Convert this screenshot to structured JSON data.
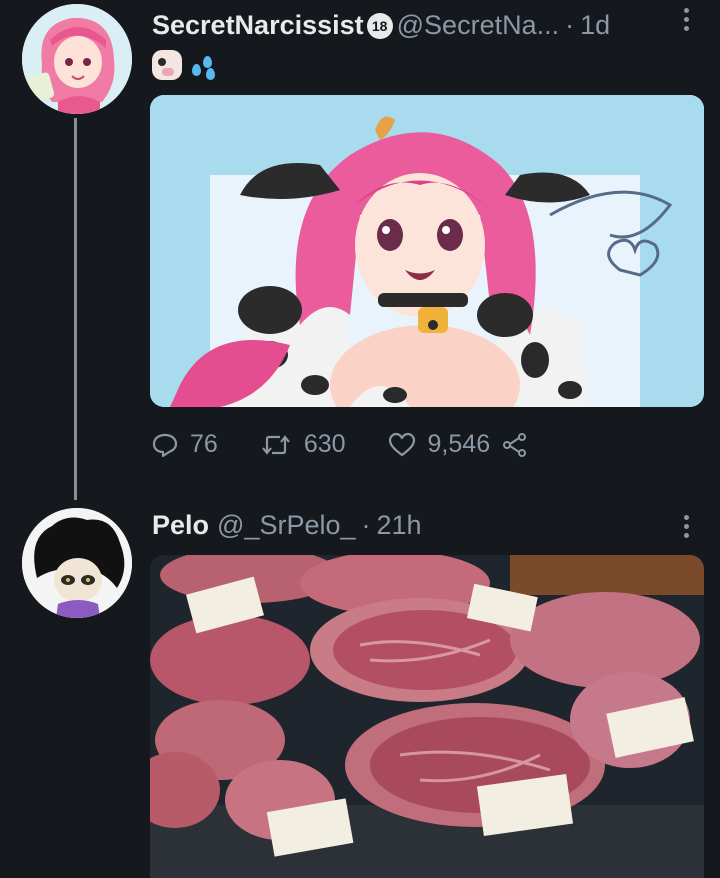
{
  "tweet1": {
    "display_name": "SecretNarcissist",
    "badge": "18",
    "handle": "@SecretNa...",
    "separator": "·",
    "time": "1d",
    "emoji_text": [
      "cow-face-emoji",
      "sweat-droplets-emoji"
    ],
    "media_description": "pink-haired cow girl anime illustration",
    "stats": {
      "replies": "76",
      "retweets": "630",
      "likes": "9,546"
    }
  },
  "tweet2": {
    "display_name": "Pelo",
    "handle": "@_SrPelo_",
    "separator": "·",
    "time": "21h",
    "media_description": "raw marbled wagyu steaks on display"
  },
  "icons": [
    "more-icon",
    "reply-icon",
    "retweet-icon",
    "like-icon",
    "share-icon"
  ],
  "colors": {
    "background": "#15181c",
    "text": "#e7e9ea",
    "muted": "#8b98a5",
    "thread": "#8a8d91"
  }
}
